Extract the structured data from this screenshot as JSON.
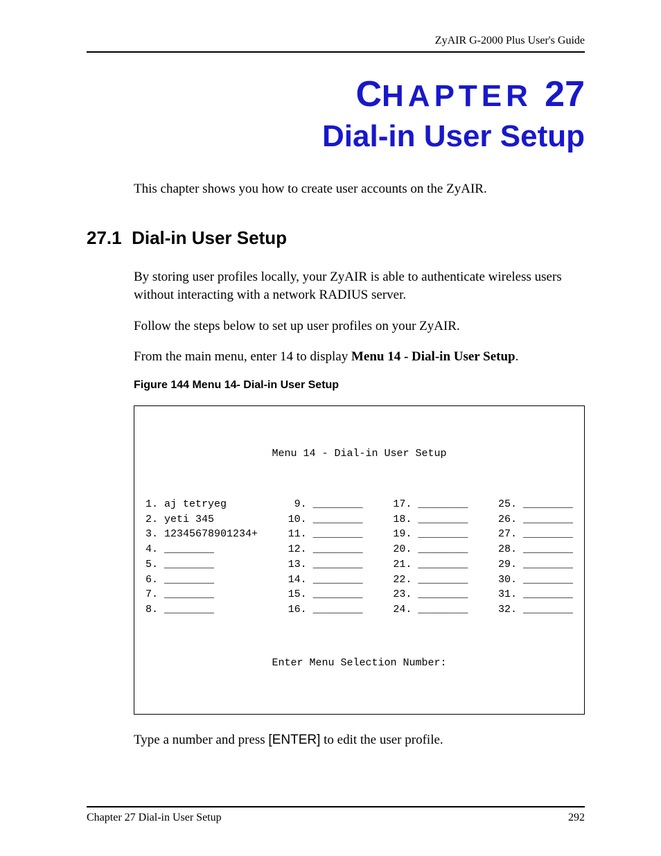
{
  "header": {
    "guide_title": "ZyAIR G-2000 Plus User's Guide"
  },
  "chapter": {
    "label_word": "HAPTER",
    "number": "27",
    "title": "Dial-in User Setup"
  },
  "intro": "This chapter shows you how to create user accounts on the ZyAIR.",
  "section": {
    "number": "27.1",
    "title": "Dial-in User Setup"
  },
  "paragraphs": {
    "p1": "By storing user profiles locally, your ZyAIR is able to authenticate wireless users without interacting with a network RADIUS server.",
    "p2": "Follow the steps below to set up user profiles on your ZyAIR.",
    "p3_pre": "From the main menu, enter 14 to display ",
    "p3_bold": "Menu 14 - Dial-in User Setup",
    "p3_post": "."
  },
  "figure": {
    "label": "Figure 144   Menu 14- Dial-in User Setup"
  },
  "menu": {
    "title": "Menu 14 - Dial-in User Setup",
    "col1": "1. aj tetryeg\n2. yeti 345\n3. 12345678901234+\n4. ________\n5. ________\n6. ________\n7. ________\n8. ________",
    "col2": " 9. ________\n10. ________\n11. ________\n12. ________\n13. ________\n14. ________\n15. ________\n16. ________",
    "col3": "17. ________\n18. ________\n19. ________\n20. ________\n21. ________\n22. ________\n23. ________\n24. ________",
    "col4": "25. ________\n26. ________\n27. ________\n28. ________\n29. ________\n30. ________\n31. ________\n32. ________",
    "footer": "Enter Menu Selection Number:"
  },
  "after_figure": {
    "pre": "Type a number and press ",
    "enter": "[ENTER]",
    "post": " to edit the user profile."
  },
  "footer": {
    "left": "Chapter 27 Dial-in User Setup",
    "right": "292"
  }
}
